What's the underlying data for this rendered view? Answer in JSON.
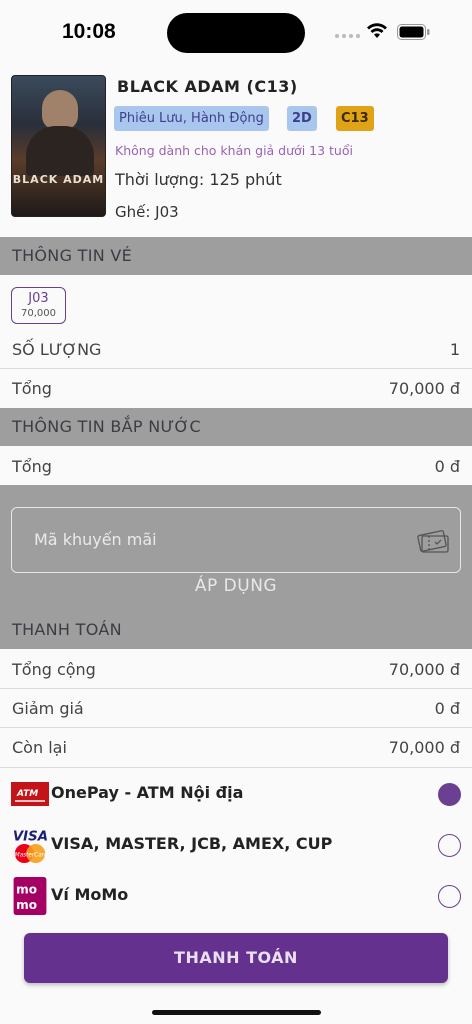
{
  "status_bar": {
    "time": "10:08"
  },
  "movie": {
    "poster_text": "BLACK ADAM",
    "title": "BLACK ADAM (C13)",
    "genre": "Phiêu Lưu, Hành Động",
    "format": "2D",
    "rating": "C13",
    "age_warning": "Không dành cho khán giả dưới 13 tuổi",
    "duration": "Thời lượng: 125 phút",
    "seat": "Ghế: J03"
  },
  "ticket_section": {
    "header": "THÔNG TIN VÉ",
    "seat_chip": {
      "code": "J03",
      "price": "70,000"
    },
    "quantity_label": "SỐ LƯỢNG",
    "quantity_value": "1",
    "total_label": "Tổng",
    "total_value": "70,000 đ"
  },
  "snack_section": {
    "header": "THÔNG TIN BẮP NƯỚC",
    "total_label": "Tổng",
    "total_value": "0 đ"
  },
  "promo": {
    "placeholder": "Mã khuyến mãi",
    "apply_label": "ÁP DỤNG"
  },
  "payment_section": {
    "header": "THANH TOÁN",
    "grand_total_label": "Tổng cộng",
    "grand_total_value": "70,000 đ",
    "discount_label": "Giảm giá",
    "discount_value": "0 đ",
    "remaining_label": "Còn lại",
    "remaining_value": "70,000 đ"
  },
  "payment_methods": [
    {
      "label": "OnePay - ATM Nội địa",
      "logo": "ATM",
      "selected": true
    },
    {
      "label": "VISA, MASTER, JCB, AMEX, CUP",
      "logo": "VISA",
      "selected": false
    },
    {
      "label": "Ví MoMo",
      "logo": "momo",
      "selected": false
    }
  ],
  "pay_button": "THANH TOÁN",
  "colors": {
    "primary": "#65318e",
    "section_bg": "#9e9e9e",
    "tag_blue": "#a9c6ee",
    "tag_orange": "#e0a317"
  }
}
